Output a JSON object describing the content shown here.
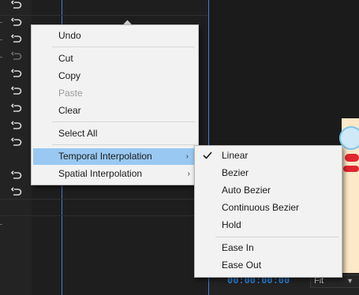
{
  "context_menu": {
    "undo": "Undo",
    "cut": "Cut",
    "copy": "Copy",
    "paste": "Paste",
    "clear": "Clear",
    "select_all": "Select All",
    "temporal_interpolation": "Temporal Interpolation",
    "spatial_interpolation": "Spatial Interpolation",
    "submenu_arrow": "›"
  },
  "interpolation_submenu": {
    "linear": "Linear",
    "bezier": "Bezier",
    "auto_bezier": "Auto Bezier",
    "continuous_bezier": "Continuous Bezier",
    "hold": "Hold",
    "ease_in": "Ease In",
    "ease_out": "Ease Out",
    "checked_item": "Linear"
  },
  "program_monitor": {
    "timecode": "00:00:00:00",
    "zoom_select": "Fit"
  },
  "icons": {
    "reset": "reset-icon",
    "check": "check-icon",
    "keyframe": "keyframe-diamond"
  },
  "colors": {
    "accent_blue": "#2d8ceb",
    "highlight": "#99c9f2",
    "menu_background": "#f2f2f2",
    "panel_background": "#232323"
  }
}
